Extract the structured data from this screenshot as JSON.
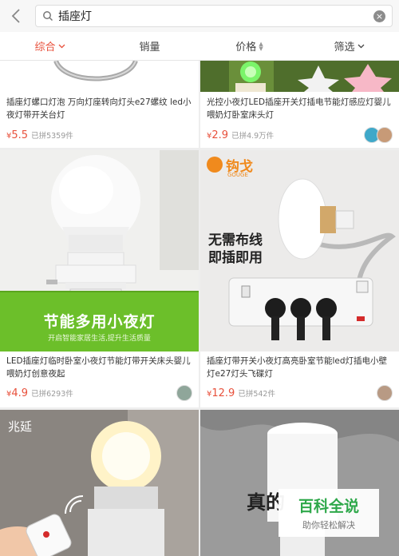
{
  "search": {
    "query": "插座灯"
  },
  "sort": {
    "tabs": [
      {
        "label": "综合",
        "state": "active"
      },
      {
        "label": "销量"
      },
      {
        "label": "价格"
      },
      {
        "label": "筛选"
      }
    ]
  },
  "products": [
    {
      "title": "插座灯螺口灯泡 万向灯座转向灯头e27螺纹 led小夜灯带开关台灯",
      "price": "5.5",
      "sold": "已拼5359件"
    },
    {
      "title": "光控小夜灯LED插座开关灯插电节能灯感应灯婴儿喂奶灯卧室床头灯",
      "price": "2.9",
      "sold": "已拼4.9万件"
    },
    {
      "title": "LED插座灯临时卧室小夜灯节能灯带开关床头婴儿喂奶灯创意夜起",
      "price": "4.9",
      "sold": "已拼6293件",
      "banner_text": "节能多用小夜灯",
      "banner_sub": "开启智能家居生活,提升生活质量"
    },
    {
      "title": "插座灯带开关小夜灯高亮卧室节能led灯插电小壁灯e27灯头飞碟灯",
      "price": "12.9",
      "sold": "已拼542件",
      "brand": "钩戈",
      "brand_sub": "GOUGE",
      "promo1": "无需布线",
      "promo2": "即插即用"
    },
    {
      "title": "",
      "price": "",
      "sold": "",
      "image_text": "兆延"
    },
    {
      "title": "",
      "price": "",
      "sold": "",
      "image_text": "真的"
    }
  ],
  "currency": "¥",
  "watermark": {
    "line1": "百科全说",
    "line2": "助你轻松解决"
  },
  "colors": {
    "accent": "#e8503b",
    "green": "#6cbf2a"
  }
}
